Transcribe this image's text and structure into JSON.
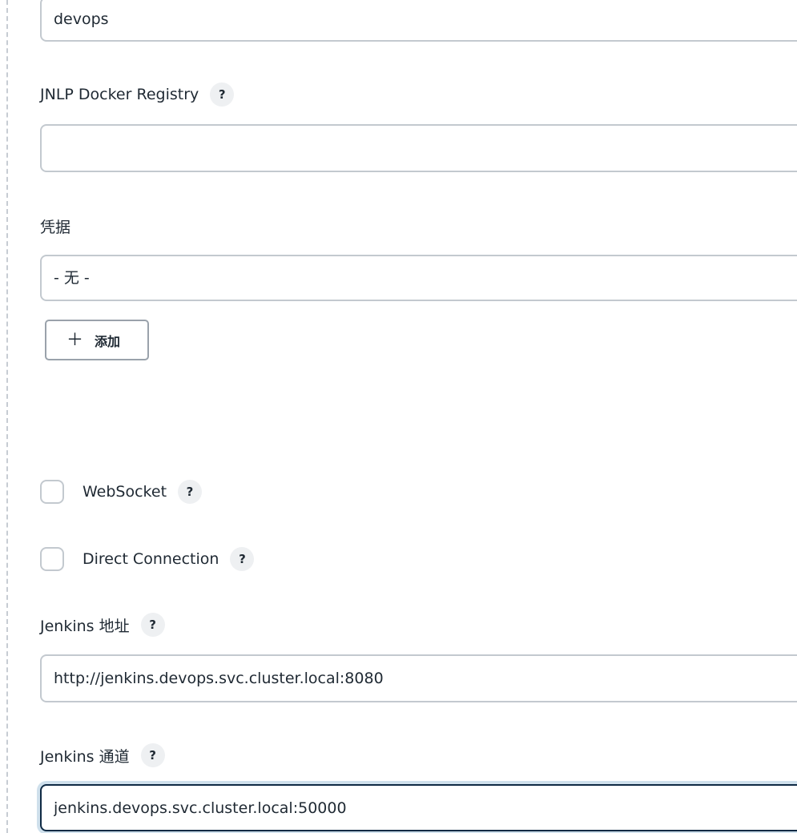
{
  "namespace": {
    "value": "devops"
  },
  "jnlp_registry": {
    "label": "JNLP Docker Registry",
    "help": "?",
    "value": ""
  },
  "credentials": {
    "label": "凭据",
    "selected": "- 无 -",
    "add_icon": "＋",
    "add_label": "添加"
  },
  "websocket": {
    "label": "WebSocket",
    "help": "?",
    "checked": false
  },
  "direct_connection": {
    "label": "Direct Connection",
    "help": "?",
    "checked": false
  },
  "jenkins_url": {
    "label": "Jenkins 地址",
    "help": "?",
    "value": "http://jenkins.devops.svc.cluster.local:8080"
  },
  "jenkins_tunnel": {
    "label": "Jenkins 通道",
    "help": "?",
    "value": "jenkins.devops.svc.cluster.local:50000"
  },
  "icons": {
    "help": "question-mark-icon",
    "add": "plus-icon"
  },
  "colors": {
    "focus_border": "#0f2a44",
    "focus_ring": "#cfe0ec",
    "input_border": "#c3c9cf",
    "help_background": "#eef0f2"
  }
}
